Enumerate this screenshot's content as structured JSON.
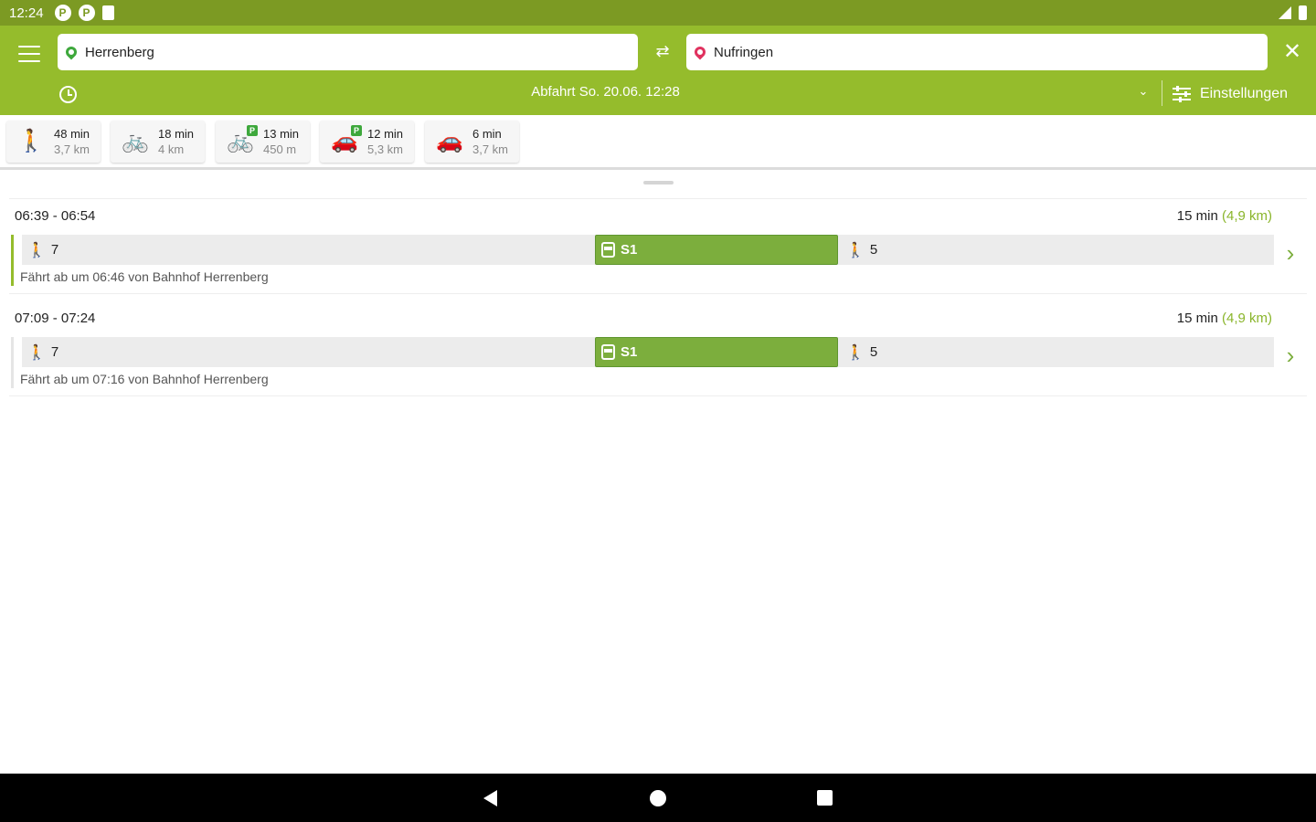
{
  "status_bar": {
    "time": "12:24",
    "notif_icons": [
      "P",
      "P"
    ]
  },
  "search": {
    "from": "Herrenberg",
    "to": "Nufringen",
    "departure": "Abfahrt  So. 20.06.  12:28",
    "settings_label": "Einstellungen"
  },
  "modes": [
    {
      "icon": "walk-icon",
      "duration": "48 min",
      "distance": "3,7 km"
    },
    {
      "icon": "bike-icon",
      "duration": "18 min",
      "distance": "4 km"
    },
    {
      "icon": "bike-and-ride-icon",
      "duration": "13 min",
      "distance": "450 m"
    },
    {
      "icon": "park-and-ride-icon",
      "duration": "12 min",
      "distance": "5,3 km"
    },
    {
      "icon": "car-icon",
      "duration": "6 min",
      "distance": "3,7 km"
    }
  ],
  "connections": [
    {
      "times": "06:39 - 06:54",
      "duration": "15 min",
      "distance": "(4,9 km)",
      "walk_before": "7",
      "line": "S1",
      "walk_after": "5",
      "info": "Fährt ab um 06:46 von Bahnhof Herrenberg"
    },
    {
      "times": "07:09 - 07:24",
      "duration": "15 min",
      "distance": "(4,9 km)",
      "walk_before": "7",
      "line": "S1",
      "walk_after": "5",
      "info": "Fährt ab um 07:16 von Bahnhof Herrenberg"
    }
  ],
  "colors": {
    "header": "#95bc2c",
    "status_bar": "#7c9a23",
    "accent": "#7cae3d",
    "from_pin": "#3ea83c",
    "to_pin": "#e0325f"
  }
}
